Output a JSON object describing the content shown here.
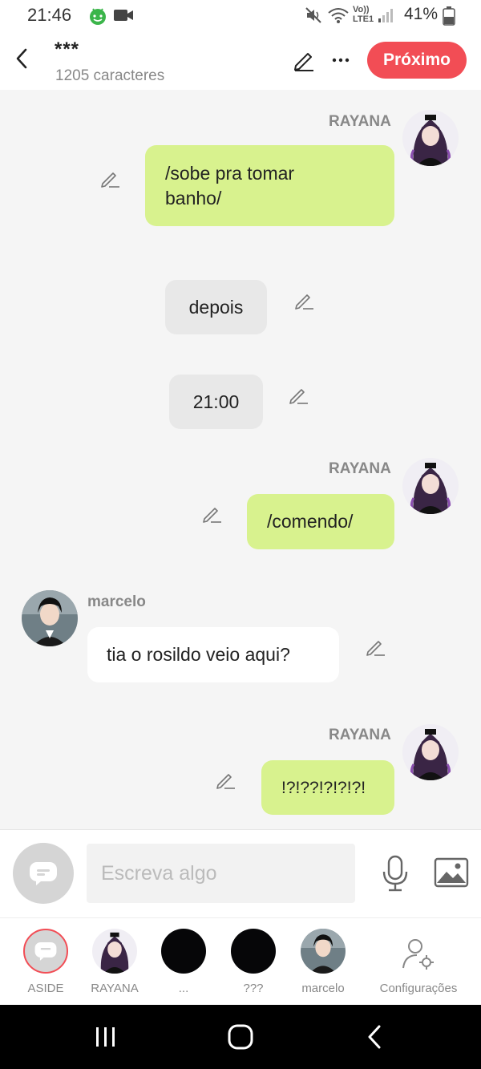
{
  "status_bar": {
    "time": "21:46",
    "battery": "41%",
    "signal_label": "Vo)) LTE1"
  },
  "header": {
    "title": "***",
    "subtitle": "1205 caracteres",
    "next_label": "Próximo",
    "accent": "#f24d55"
  },
  "messages": [
    {
      "sender": "RAYANA",
      "side": "right",
      "text_lines": [
        "/sobe pra tomar",
        "banho/"
      ],
      "style": "green"
    },
    {
      "side": "center",
      "text": "depois",
      "style": "gray"
    },
    {
      "side": "center",
      "text": "21:00",
      "style": "gray"
    },
    {
      "sender": "RAYANA",
      "side": "right",
      "text": "/comendo/",
      "style": "green"
    },
    {
      "sender": "marcelo",
      "side": "left",
      "text": "tia o rosildo veio aqui?",
      "style": "white"
    },
    {
      "sender": "RAYANA",
      "side": "right",
      "text": "!?!??!?!?!?!",
      "style": "green"
    }
  ],
  "composer": {
    "placeholder": "Escreva algo"
  },
  "tabs": [
    {
      "label": "ASIDE"
    },
    {
      "label": "RAYANA"
    },
    {
      "label": "..."
    },
    {
      "label": "???"
    },
    {
      "label": "marcelo"
    },
    {
      "label": "Configurações"
    }
  ],
  "colors": {
    "green_bubble": "#d8f28e",
    "gray_bubble": "#e8e8e8",
    "background": "#f5f5f5"
  }
}
